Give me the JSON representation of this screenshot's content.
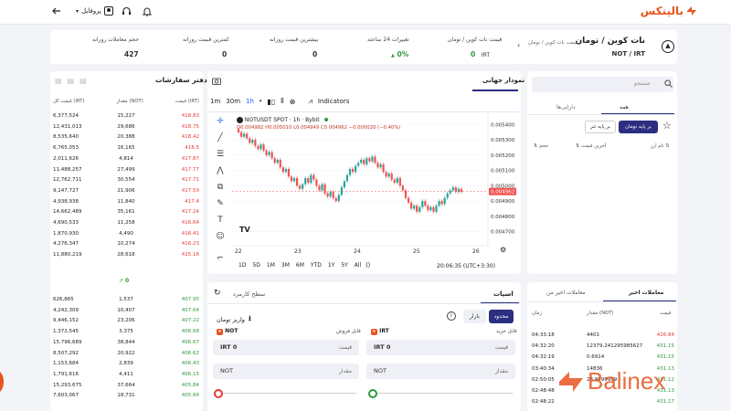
{
  "topbar": {
    "logo_text": "بالینکس",
    "profile_label": "پروفایل",
    "icons": [
      "arrow-left-icon",
      "chevron-down-icon",
      "user-icon",
      "headset-icon",
      "bell-icon"
    ]
  },
  "pair": {
    "title": "نات کوین / تومان",
    "breadcrumb": "قیمت نات کوین / تومان",
    "symbol": "NOT / IRT"
  },
  "stats": [
    {
      "label": "قیمت نات کوین / تومان",
      "value": "0",
      "unit": "IRT"
    },
    {
      "label": "تغییرات 24 ساعته",
      "value": "0%"
    },
    {
      "label": "بیشترین قیمت روزانه",
      "value": "0"
    },
    {
      "label": "کمترین قیمت روزانه",
      "value": "0"
    },
    {
      "label": "حجم معاملات روزانه",
      "value": "427"
    }
  ],
  "market": {
    "search_placeholder": "جستجو",
    "tabs": [
      "همه",
      "دارایی‌ها"
    ],
    "base_buttons": [
      "بر پایه تومان",
      "بر پایه تتر"
    ],
    "columns": [
      "نام ارز",
      "آخرین قیمت",
      "حجم"
    ]
  },
  "chart": {
    "panel_title": "نمودار جهانی",
    "intervals": [
      "1m",
      "30m",
      "1h"
    ],
    "indicators_label": "Indicators",
    "legend": "NOTUSDT SPOT · 1h · Bybit",
    "ohlc": "O0.004982 H0.005010 L0.004949 C0.004962 −0.000020 (−0.40%)",
    "price_ticks": [
      "0.005400",
      "0.005300",
      "0.005200",
      "0.005100",
      "0.005000",
      "0.004900",
      "0.004800",
      "0.004700"
    ],
    "current_price": "0.004962",
    "date_ticks": [
      "22",
      "23",
      "24",
      "25",
      "26"
    ],
    "ranges": [
      "1D",
      "5D",
      "1M",
      "3M",
      "6M",
      "YTD",
      "1Y",
      "5Y",
      "All"
    ],
    "clock": "20:06:35 (UTC+3:30)"
  },
  "orderbook": {
    "title": "دفتر سفارشات",
    "columns": [
      "قیمت (IRT)",
      "مقدار (NOT)",
      "قیمت کل (IRT)"
    ],
    "asks": [
      [
        "418.83",
        "15,227",
        "6,377,524"
      ],
      [
        "418.75",
        "29,686",
        "12,431,013"
      ],
      [
        "418.42",
        "20,388",
        "8,535,640"
      ],
      [
        "418.5",
        "16,165",
        "6,765,053"
      ],
      [
        "417.87",
        "4,814",
        "2,011,626"
      ],
      [
        "417.77",
        "27,499",
        "11,488,257"
      ],
      [
        "417.71",
        "30,554",
        "12,762,711"
      ],
      [
        "417.59",
        "21,906",
        "9,147,727"
      ],
      [
        "417.4",
        "11,840",
        "4,938,938"
      ],
      [
        "417.24",
        "35,161",
        "14,662,489"
      ],
      [
        "416.64",
        "11,258",
        "4,690,533"
      ],
      [
        "416.41",
        "4,490",
        "1,870,930"
      ],
      [
        "416.23",
        "10,274",
        "4,276,347"
      ],
      [
        "415.16",
        "28,618",
        "11,880,219"
      ]
    ],
    "mid": "0",
    "bids": [
      [
        "407.95",
        "1,537",
        "626,865"
      ],
      [
        "407.64",
        "10,407",
        "4,242,309"
      ],
      [
        "407.22",
        "23,206",
        "9,446,152"
      ],
      [
        "406.68",
        "3,375",
        "1,372,545"
      ],
      [
        "406.67",
        "38,844",
        "15,796,689"
      ],
      [
        "406.62",
        "20,922",
        "8,507,292"
      ],
      [
        "406.43",
        "2,839",
        "1,153,684"
      ],
      [
        "406.15",
        "4,411",
        "1,791,616"
      ],
      [
        "405.84",
        "37,664",
        "15,293,675"
      ],
      [
        "405.84",
        "18,731",
        "7,603,067"
      ]
    ]
  },
  "order_form": {
    "tabs": [
      "اسپات",
      "سطح کارمزد"
    ],
    "types": [
      "محدود",
      "بازار"
    ],
    "deposit_label": "واریز تومان",
    "buy": {
      "available_label": "قابل خرید",
      "currency": "IRT",
      "price_label": "قیمت",
      "amount_label": "مقدار",
      "price_value": "0",
      "amount_value": "NOT"
    },
    "sell": {
      "available_label": "قابل فروش",
      "currency": "NOT",
      "price_label": "قیمت",
      "amount_label": "مقدار",
      "price_value": "0",
      "amount_value": "NOT",
      "price_currency": "IRT"
    }
  },
  "trades": {
    "tabs": [
      "معاملات اخیر",
      "معاملات اخیر من"
    ],
    "columns": [
      "قیمت",
      "مقدار (NOT)",
      "زمان"
    ],
    "rows": [
      [
        "426.84",
        "4401",
        "04:33:18",
        "red"
      ],
      [
        "431.15",
        "12379.241295985627",
        "04:32:20",
        "green"
      ],
      [
        "431.15",
        "0.6914",
        "04:32:19",
        "green"
      ],
      [
        "431.13",
        "14836",
        "03:40:34",
        "green"
      ],
      [
        "431.12",
        "23.9999999",
        "02:50:05",
        "green"
      ],
      [
        "431.13",
        "",
        "02:48:48",
        "green"
      ],
      [
        "431.17",
        "",
        "02:48:22",
        "green"
      ]
    ]
  },
  "watermark": "Balinex",
  "colors": {
    "brand": "#e8541f",
    "primary": "#2c2e80",
    "up": "#2e9a3a",
    "down": "#e53935"
  }
}
